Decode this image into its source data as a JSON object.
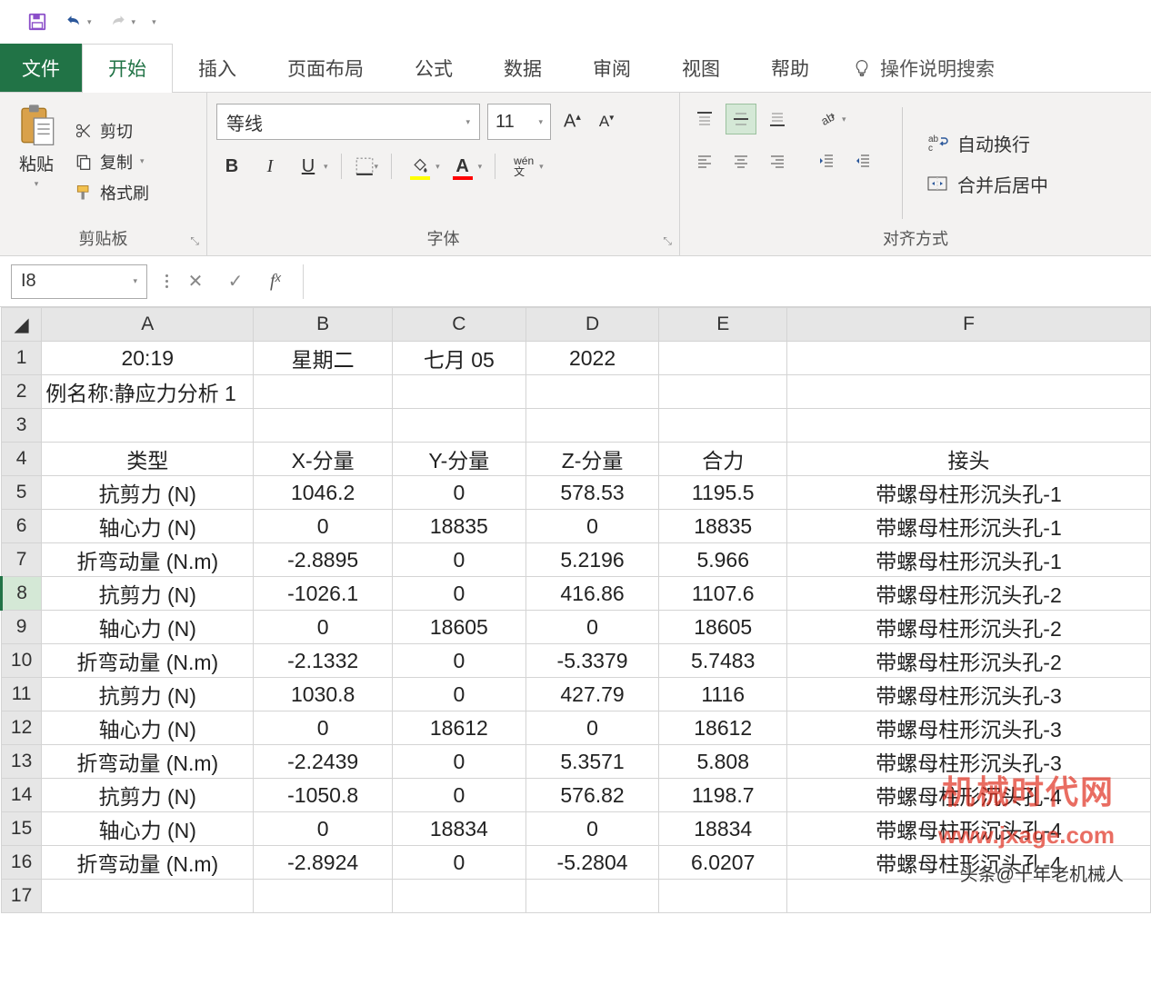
{
  "qat": {
    "save": "save",
    "undo": "undo",
    "redo": "redo"
  },
  "tabs": {
    "file": "文件",
    "home": "开始",
    "insert": "插入",
    "layout": "页面布局",
    "formula": "公式",
    "data": "数据",
    "review": "审阅",
    "view": "视图",
    "help": "帮助",
    "tellme": "操作说明搜索"
  },
  "ribbon": {
    "clipboard": {
      "paste": "粘贴",
      "cut": "剪切",
      "copy": "复制",
      "painter": "格式刷",
      "group": "剪贴板"
    },
    "font": {
      "name": "等线",
      "size": "11",
      "group": "字体",
      "bold": "B",
      "italic": "I",
      "underline": "U",
      "phonetic": "wén\n文"
    },
    "align": {
      "group": "对齐方式",
      "wrap": "自动换行",
      "merge": "合并后居中"
    }
  },
  "formulaBar": {
    "nameBox": "I8",
    "value": ""
  },
  "columns": [
    "A",
    "B",
    "C",
    "D",
    "E",
    "F"
  ],
  "selectedRow": 8,
  "rows": [
    {
      "n": 1,
      "c": [
        "20:19",
        "星期二",
        "七月 05",
        "2022",
        "",
        ""
      ]
    },
    {
      "n": 2,
      "c": [
        "例名称:静应力分析 1",
        "",
        "",
        "",
        "",
        ""
      ]
    },
    {
      "n": 3,
      "c": [
        "",
        "",
        "",
        "",
        "",
        ""
      ]
    },
    {
      "n": 4,
      "c": [
        "类型",
        "X-分量",
        "Y-分量",
        "Z-分量",
        "合力",
        "接头"
      ]
    },
    {
      "n": 5,
      "c": [
        "抗剪力 (N)",
        "1046.2",
        "0",
        "578.53",
        "1195.5",
        "带螺母柱形沉头孔-1"
      ]
    },
    {
      "n": 6,
      "c": [
        "轴心力 (N)",
        "0",
        "18835",
        "0",
        "18835",
        "带螺母柱形沉头孔-1"
      ]
    },
    {
      "n": 7,
      "c": [
        "折弯动量 (N.m)",
        "-2.8895",
        "0",
        "5.2196",
        "5.966",
        "带螺母柱形沉头孔-1"
      ]
    },
    {
      "n": 8,
      "c": [
        "抗剪力 (N)",
        "-1026.1",
        "0",
        "416.86",
        "1107.6",
        "带螺母柱形沉头孔-2"
      ]
    },
    {
      "n": 9,
      "c": [
        "轴心力 (N)",
        "0",
        "18605",
        "0",
        "18605",
        "带螺母柱形沉头孔-2"
      ]
    },
    {
      "n": 10,
      "c": [
        "折弯动量 (N.m)",
        "-2.1332",
        "0",
        "-5.3379",
        "5.7483",
        "带螺母柱形沉头孔-2"
      ]
    },
    {
      "n": 11,
      "c": [
        "抗剪力 (N)",
        "1030.8",
        "0",
        "427.79",
        "1116",
        "带螺母柱形沉头孔-3"
      ]
    },
    {
      "n": 12,
      "c": [
        "轴心力 (N)",
        "0",
        "18612",
        "0",
        "18612",
        "带螺母柱形沉头孔-3"
      ]
    },
    {
      "n": 13,
      "c": [
        "折弯动量 (N.m)",
        "-2.2439",
        "0",
        "5.3571",
        "5.808",
        "带螺母柱形沉头孔-3"
      ]
    },
    {
      "n": 14,
      "c": [
        "抗剪力 (N)",
        "-1050.8",
        "0",
        "576.82",
        "1198.7",
        "带螺母柱形沉头孔-4"
      ]
    },
    {
      "n": 15,
      "c": [
        "轴心力 (N)",
        "0",
        "18834",
        "0",
        "18834",
        "带螺母柱形沉头孔-4"
      ]
    },
    {
      "n": 16,
      "c": [
        "折弯动量 (N.m)",
        "-2.8924",
        "0",
        "-5.2804",
        "6.0207",
        "带螺母柱形沉头孔-4"
      ]
    },
    {
      "n": 17,
      "c": [
        "",
        "",
        "",
        "",
        "",
        ""
      ]
    }
  ],
  "watermark": {
    "line1": "机械时代网",
    "line2": "www.jxage.com",
    "credit": "头条@十年老机械人"
  }
}
